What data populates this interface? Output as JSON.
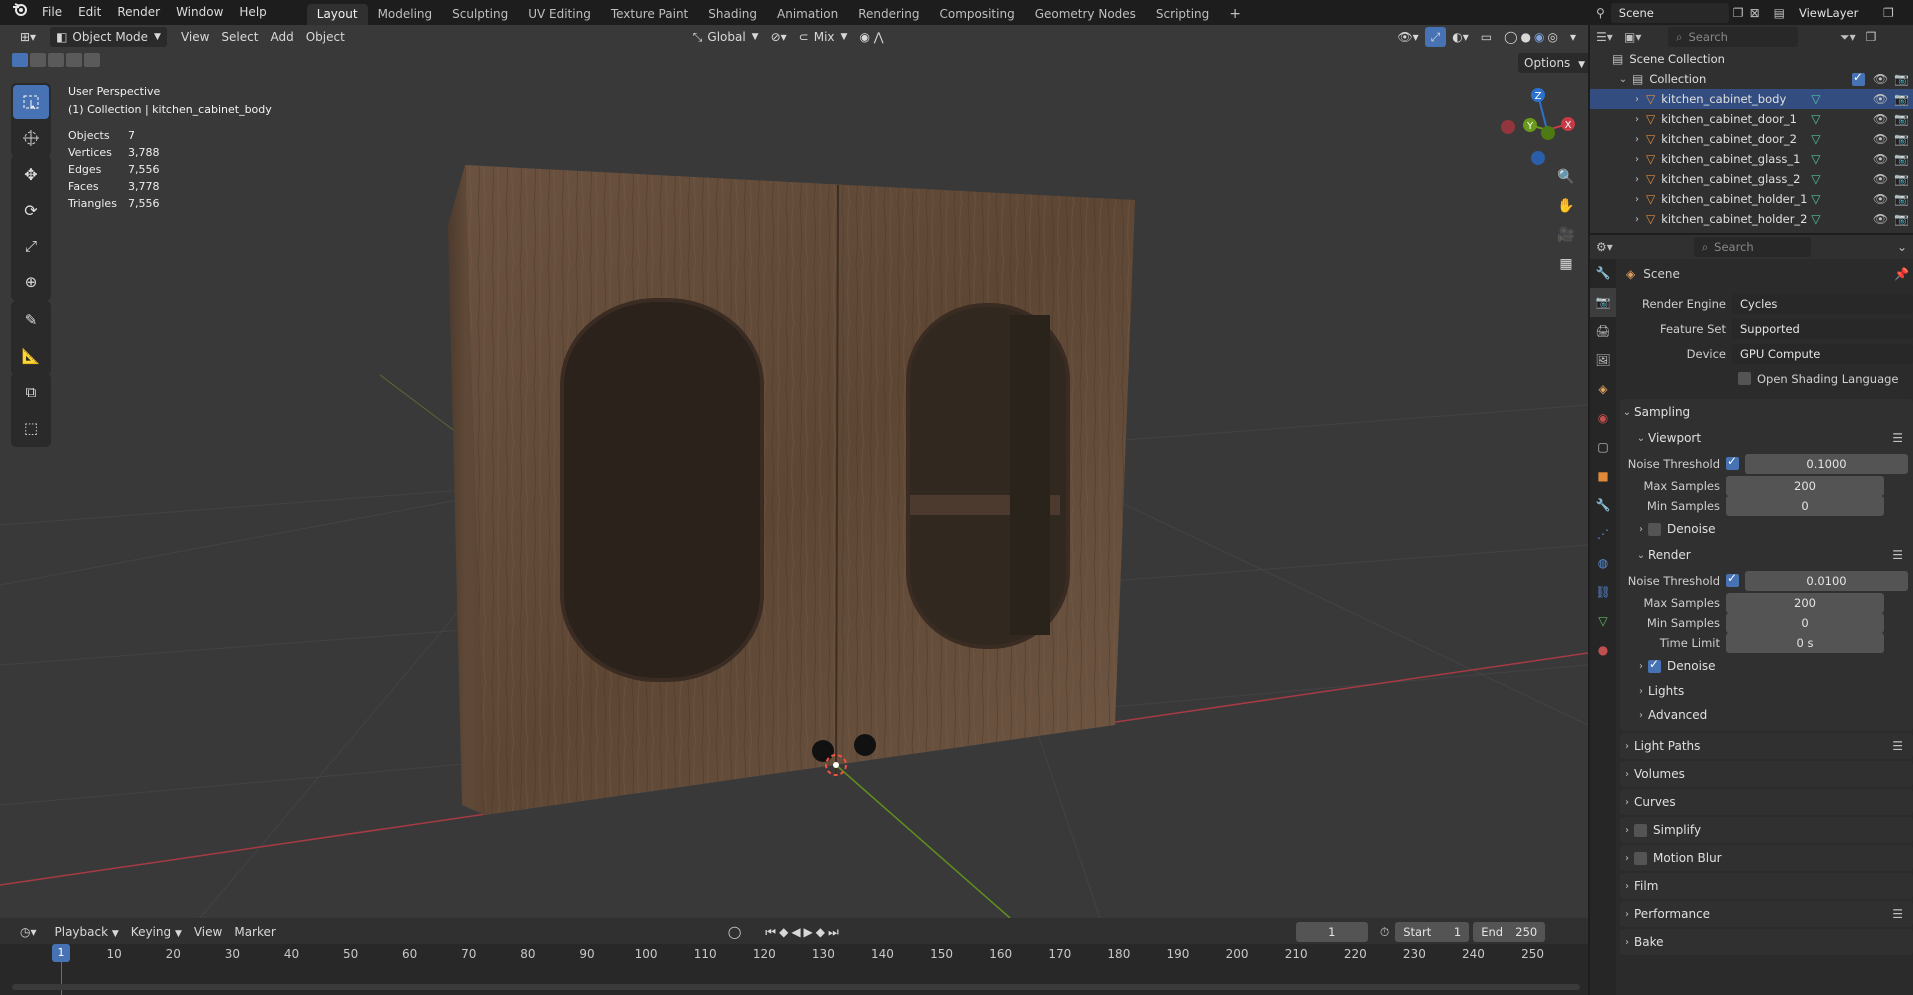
{
  "topbar": {
    "menus": [
      "File",
      "Edit",
      "Render",
      "Window",
      "Help"
    ],
    "workspaces": [
      "Layout",
      "Modeling",
      "Sculpting",
      "UV Editing",
      "Texture Paint",
      "Shading",
      "Animation",
      "Rendering",
      "Compositing",
      "Geometry Nodes",
      "Scripting"
    ],
    "active_workspace": "Layout",
    "scene_name": "Scene",
    "view_layer": "ViewLayer"
  },
  "viewport": {
    "mode": "Object Mode",
    "menus": [
      "View",
      "Select",
      "Add",
      "Object"
    ],
    "transform_orientation": "Global",
    "proportional_mode": "Mix",
    "options_label": "Options",
    "view_name": "User Perspective",
    "collection_info": "(1) Collection | kitchen_cabinet_body",
    "stats": [
      {
        "label": "Objects",
        "value": "7"
      },
      {
        "label": "Vertices",
        "value": "3,788"
      },
      {
        "label": "Edges",
        "value": "7,556"
      },
      {
        "label": "Faces",
        "value": "3,778"
      },
      {
        "label": "Triangles",
        "value": "7,556"
      }
    ],
    "gizmo_axes": {
      "x": "X",
      "y": "Y",
      "z": "Z"
    },
    "colors": {
      "bg": "#393939",
      "wood": "#6e5440",
      "axis_x": "#c63a45",
      "axis_y": "#6a9a1c",
      "axis_z": "#2c71cc"
    }
  },
  "timeline": {
    "menus": [
      "Playback",
      "Keying",
      "View",
      "Marker"
    ],
    "current_frame": "1",
    "start_label": "Start",
    "start": "1",
    "end_label": "End",
    "end": "250",
    "ticks": [
      "1",
      "10",
      "20",
      "30",
      "40",
      "50",
      "60",
      "70",
      "80",
      "90",
      "100",
      "110",
      "120",
      "130",
      "140",
      "150",
      "160",
      "170",
      "180",
      "190",
      "200",
      "210",
      "220",
      "230",
      "240",
      "250"
    ]
  },
  "outliner": {
    "search_placeholder": "Search",
    "scene_collection": "Scene Collection",
    "collection": "Collection",
    "items": [
      "kitchen_cabinet_body",
      "kitchen_cabinet_door_1",
      "kitchen_cabinet_door_2",
      "kitchen_cabinet_glass_1",
      "kitchen_cabinet_glass_2",
      "kitchen_cabinet_holder_1",
      "kitchen_cabinet_holder_2"
    ],
    "selected_item": "kitchen_cabinet_body"
  },
  "properties": {
    "search_placeholder": "Search",
    "context": "Scene",
    "render_engine_label": "Render Engine",
    "render_engine": "Cycles",
    "feature_set_label": "Feature Set",
    "feature_set": "Supported",
    "device_label": "Device",
    "device": "GPU Compute",
    "osl_label": "Open Shading Language",
    "sampling": {
      "title": "Sampling",
      "viewport_title": "Viewport",
      "viewport_noise_label": "Noise Threshold",
      "viewport_noise": "0.1000",
      "viewport_max_label": "Max Samples",
      "viewport_max": "200",
      "viewport_min_label": "Min Samples",
      "viewport_min": "0",
      "denoise_label": "Denoise",
      "render_title": "Render",
      "render_noise_label": "Noise Threshold",
      "render_noise": "0.0100",
      "render_max_label": "Max Samples",
      "render_max": "200",
      "render_min_label": "Min Samples",
      "render_min": "0",
      "time_limit_label": "Time Limit",
      "time_limit": "0 s",
      "render_denoise_label": "Denoise",
      "lights": "Lights",
      "advanced": "Advanced"
    },
    "panels": [
      "Light Paths",
      "Volumes",
      "Curves",
      "Simplify",
      "Motion Blur",
      "Film",
      "Performance",
      "Bake"
    ]
  }
}
